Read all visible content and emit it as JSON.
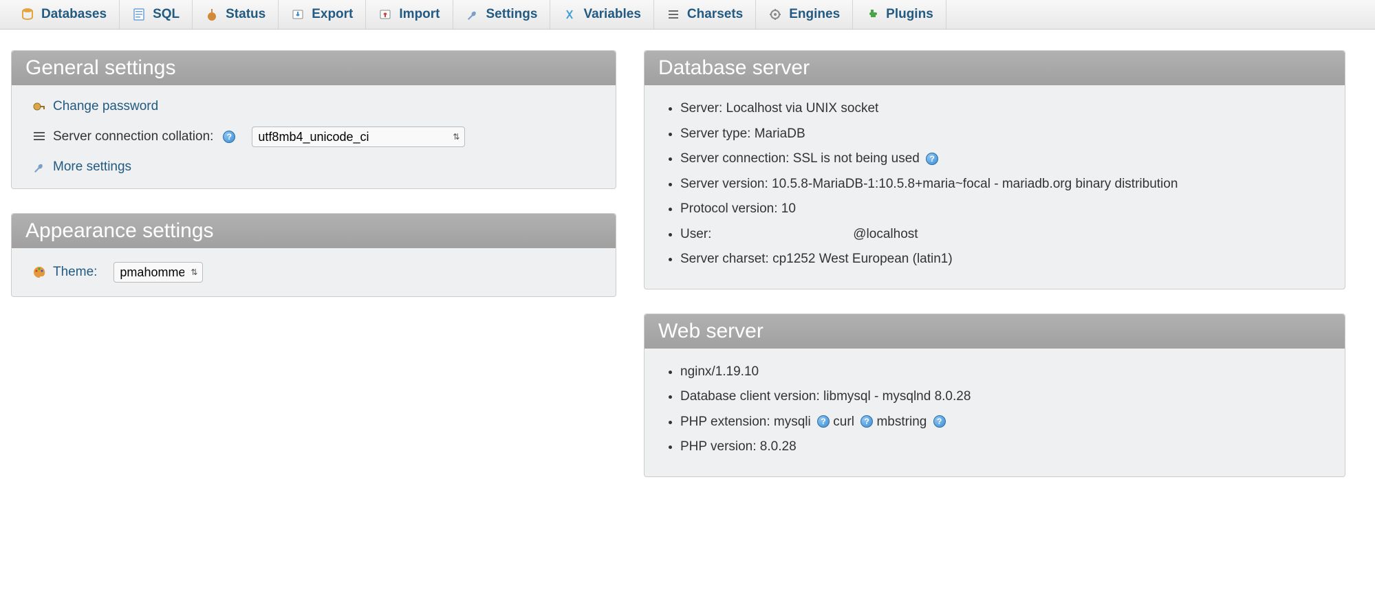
{
  "topnav": [
    {
      "label": "Databases",
      "icon": "database-icon",
      "color": "#e4a440"
    },
    {
      "label": "SQL",
      "icon": "sql-icon",
      "color": "#6aa0d8"
    },
    {
      "label": "Status",
      "icon": "status-icon",
      "color": "#d28a3a"
    },
    {
      "label": "Export",
      "icon": "export-icon",
      "color": "#3c8fcf"
    },
    {
      "label": "Import",
      "icon": "import-icon",
      "color": "#d33a3a"
    },
    {
      "label": "Settings",
      "icon": "wrench-icon",
      "color": "#7a9fc8"
    },
    {
      "label": "Variables",
      "icon": "variables-icon",
      "color": "#3ca0d4"
    },
    {
      "label": "Charsets",
      "icon": "charsets-icon",
      "color": "#6a6a6a"
    },
    {
      "label": "Engines",
      "icon": "engines-icon",
      "color": "#8a8a8a"
    },
    {
      "label": "Plugins",
      "icon": "plugins-icon",
      "color": "#47a447"
    }
  ],
  "panels": {
    "general": {
      "title": "General settings",
      "change_password": "Change password",
      "collation_label": "Server connection collation:",
      "collation_value": "utf8mb4_unicode_ci",
      "more_settings": "More settings"
    },
    "appearance": {
      "title": "Appearance settings",
      "theme_label": "Theme:",
      "theme_value": "pmahomme"
    },
    "db_server": {
      "title": "Database server",
      "items": [
        "Server: Localhost via UNIX socket",
        "Server type: MariaDB",
        "Server connection: SSL is not being used",
        "Server version: 10.5.8-MariaDB-1:10.5.8+maria~focal - mariadb.org binary distribution",
        "Protocol version: 10",
        "User:                                       @localhost",
        "Server charset: cp1252 West European (latin1)"
      ]
    },
    "web_server": {
      "title": "Web server",
      "items": [
        "nginx/1.19.10",
        "Database client version: libmysql - mysqlnd 8.0.28",
        "PHP extension: mysqli  curl  mbstring",
        "PHP version: 8.0.28"
      ]
    }
  }
}
